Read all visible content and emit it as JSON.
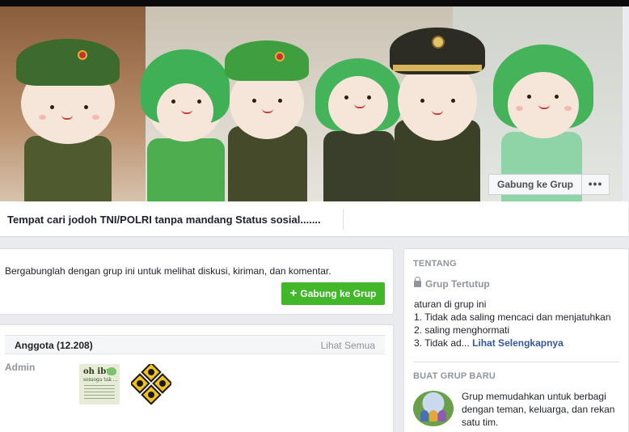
{
  "cover": {
    "join_button": "Gabung ke Grup",
    "more_button": "•••"
  },
  "group": {
    "title": "Tempat cari jodoh TNI/POLRI tanpa mandang Status sosial......."
  },
  "join_card": {
    "message": "Bergabunglah dengan grup ini untuk melihat diskusi, kiriman, dan komentar.",
    "button_label": "Gabung ke Grup"
  },
  "members": {
    "count_label": "Anggota (12.208)",
    "see_all": "Lihat Semua",
    "admin_label": "Admin",
    "avatar1_line1": "oh ibu",
    "avatar1_line2": "semoga tak ..."
  },
  "about": {
    "section_title": "TENTANG",
    "privacy": "Grup Tertutup",
    "rules_title": "aturan di grup ini",
    "rule1": "1. Tidak ada saling mencaci dan menjatuhkan",
    "rule2": "2. saling menghormati",
    "rule3": "3. Tidak ad...",
    "see_more": "Lihat Selengkapnya"
  },
  "create_group": {
    "section_title": "BUAT GRUP BARU",
    "description": "Grup memudahkan untuk berbagi dengan teman, keluarga, dan rekan satu tim."
  },
  "colors": {
    "primary_green": "#42b72a",
    "link_blue": "#365899",
    "muted_gray": "#90949c",
    "page_bg": "#e9ebee"
  },
  "icons": {
    "more": "ellipsis-icon",
    "lock": "lock-icon",
    "plus": "plus-icon",
    "create_group": "group-people-icon"
  }
}
